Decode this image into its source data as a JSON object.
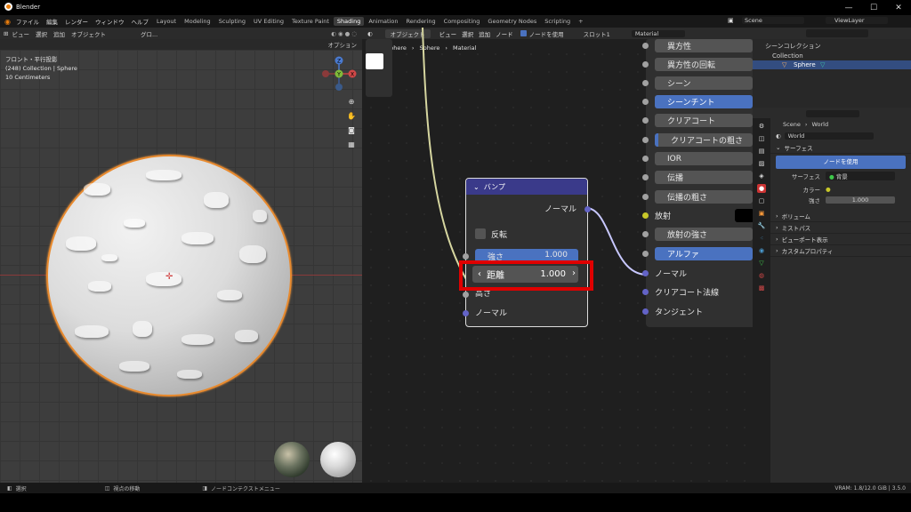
{
  "window": {
    "title": "Blender",
    "controls": [
      "—",
      "☐",
      "✕"
    ]
  },
  "topbar": {
    "menu": [
      "ファイル",
      "編集",
      "レンダー",
      "ウィンドウ",
      "ヘルプ"
    ],
    "workspaces": [
      "Layout",
      "Modeling",
      "Sculpting",
      "UV Editing",
      "Texture Paint",
      "Shading",
      "Animation",
      "Rendering",
      "Compositing",
      "Geometry Nodes",
      "Scripting",
      "+"
    ],
    "active_workspace": "Shading",
    "scene": "Scene",
    "view_layer": "ViewLayer"
  },
  "viewport": {
    "menu": [
      "ビュー",
      "選択",
      "追加",
      "オブジェクト"
    ],
    "transform": "グロ...",
    "options": "オプション",
    "info": [
      "フロント・平行投影",
      "(248) Collection | Sphere",
      "10 Centimeters"
    ],
    "gizmo": {
      "z": "Z",
      "y": "Y",
      "x": "X"
    },
    "nav_icons": [
      "zoom-icon",
      "hand-icon",
      "camera-icon",
      "grid-icon"
    ]
  },
  "node_editor": {
    "object_mode": "オブジェクト",
    "menu": [
      "ビュー",
      "選択",
      "追加",
      "ノード"
    ],
    "use_nodes": "ノードを使用",
    "slot": "スロット1",
    "material": "Material",
    "breadcrumb": [
      "Sphere",
      "Sphere",
      "Material"
    ],
    "bump_node": {
      "title": "バンプ",
      "output": "ノーマル",
      "invert": "反転",
      "strength_label": "強さ",
      "strength_value": "1.000",
      "distance_label": "距離",
      "distance_value": "1.000",
      "height": "高さ",
      "normal_in": "ノーマル"
    },
    "principled_inputs": [
      {
        "label": "異方性",
        "style": "gray"
      },
      {
        "label": "異方性の回転",
        "style": "gray"
      },
      {
        "label": "シーン",
        "style": "gray"
      },
      {
        "label": "シーンチント",
        "style": "blue"
      },
      {
        "label": "クリアコート",
        "style": "gray"
      },
      {
        "label": "クリアコートの粗さ",
        "style": "blue"
      },
      {
        "label": "IOR",
        "style": "gray"
      },
      {
        "label": "伝播",
        "style": "gray"
      },
      {
        "label": "伝播の粗さ",
        "style": "gray"
      },
      {
        "label": "放射",
        "style": "label"
      },
      {
        "label": "放射の強さ",
        "style": "gray"
      },
      {
        "label": "アルファ",
        "style": "blue"
      },
      {
        "label": "ノーマル",
        "style": "label"
      },
      {
        "label": "クリアコート法線",
        "style": "label"
      },
      {
        "label": "タンジェント",
        "style": "label"
      }
    ]
  },
  "outliner": {
    "header": "シーンコレクション",
    "items": [
      {
        "label": "Collection"
      },
      {
        "label": "Sphere"
      }
    ]
  },
  "properties": {
    "breadcrumb": [
      "Scene",
      "World"
    ],
    "world_name": "World",
    "sections": [
      "サーフェス",
      "ボリューム",
      "ミストパス",
      "ビューポート表示",
      "カスタムプロパティ"
    ],
    "use_nodes_button": "ノードを使用",
    "surface_label": "サーフェス",
    "surface_value": "背景",
    "color_label": "カラー",
    "strength_label": "強さ",
    "strength_value": "1.000"
  },
  "statusbar": {
    "items": [
      "選択",
      "視点の移動",
      "ノードコンテクストメニュー"
    ],
    "vram": "VRAM: 1.8/12.0 GiB | 3.5.0"
  },
  "colors": {
    "accent_blue": "#4a72c0",
    "highlight_red": "#e00000",
    "selection_orange": "#e88a2e",
    "node_header": "#3a3a8a"
  }
}
